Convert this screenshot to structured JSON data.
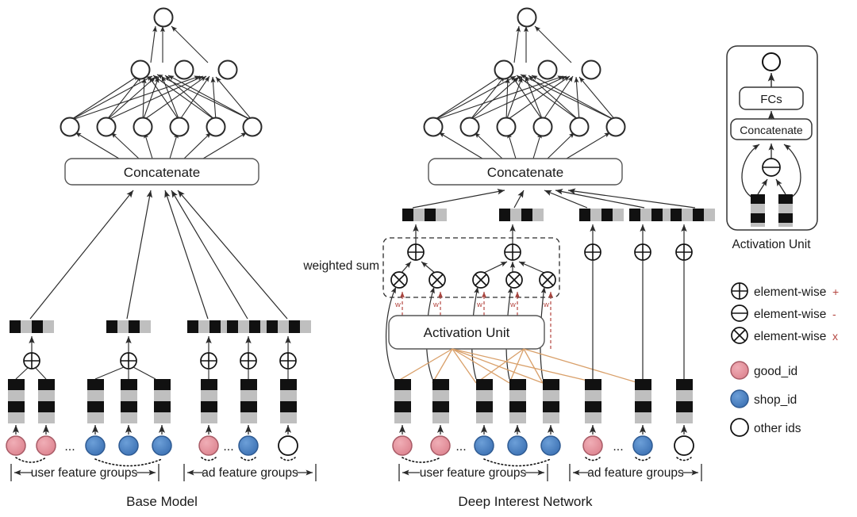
{
  "figure": {
    "base_model_title": "Base Model",
    "din_title": "Deep Interest Network"
  },
  "base": {
    "concat_label": "Concatenate",
    "user_group_label": "user feature groups",
    "ad_group_label": "ad feature groups",
    "ellipsis": "...",
    "mlp": {
      "out_nodes": 1,
      "hidden2_nodes": 3,
      "hidden1_nodes": 6
    },
    "inputs": [
      {
        "id": "good_id",
        "color": "#e4929c"
      },
      {
        "id": "good_id",
        "color": "#e4929c"
      },
      {
        "id": "shop_id",
        "color": "#4e83c4"
      },
      {
        "id": "shop_id",
        "color": "#4e83c4"
      },
      {
        "id": "shop_id",
        "color": "#4e83c4"
      },
      {
        "id": "good_id",
        "color": "#e4929c"
      },
      {
        "id": "shop_id",
        "color": "#4e83c4"
      },
      {
        "id": "other ids",
        "color": "#ffffff"
      }
    ]
  },
  "din": {
    "concat_label": "Concatenate",
    "activation_unit_label": "Activation Unit",
    "weighted_sum_label": "weighted sum",
    "weight_label": "w",
    "user_group_label": "user feature groups",
    "ad_group_label": "ad feature groups",
    "ellipsis": "...",
    "mlp": {
      "out_nodes": 1,
      "hidden2_nodes": 3,
      "hidden1_nodes": 6
    },
    "inputs": [
      {
        "id": "good_id",
        "color": "#e4929c"
      },
      {
        "id": "good_id",
        "color": "#e4929c"
      },
      {
        "id": "shop_id",
        "color": "#4e83c4"
      },
      {
        "id": "shop_id",
        "color": "#4e83c4"
      },
      {
        "id": "shop_id",
        "color": "#4e83c4"
      },
      {
        "id": "good_id",
        "color": "#e4929c"
      },
      {
        "id": "shop_id",
        "color": "#4e83c4"
      },
      {
        "id": "other ids",
        "color": "#ffffff"
      }
    ]
  },
  "activation_unit_panel": {
    "caption": "Activation Unit",
    "fcs_label": "FCs",
    "concat_label": "Concatenate",
    "minus_symbol": "element-wise -"
  },
  "legend": {
    "ops": [
      {
        "symbol": "plus",
        "text": "element-wise",
        "op": "+"
      },
      {
        "symbol": "minus",
        "text": "element-wise",
        "op": "-"
      },
      {
        "symbol": "times",
        "text": "element-wise",
        "op": "x"
      }
    ],
    "nodes": [
      {
        "label": "good_id",
        "color": "#e4929c"
      },
      {
        "label": "shop_id",
        "color": "#4e83c4"
      },
      {
        "label": "other ids",
        "color": "#ffffff"
      }
    ],
    "op_color": "#b4453f"
  },
  "colors": {
    "line": "#2b2b2b",
    "orange": "#d9a06a",
    "red": "#b4453f",
    "black_seg": "#111111",
    "gray_seg": "#bfbfbf",
    "good_id": "#e4929c",
    "shop_id": "#4e83c4",
    "other_id": "#ffffff"
  }
}
